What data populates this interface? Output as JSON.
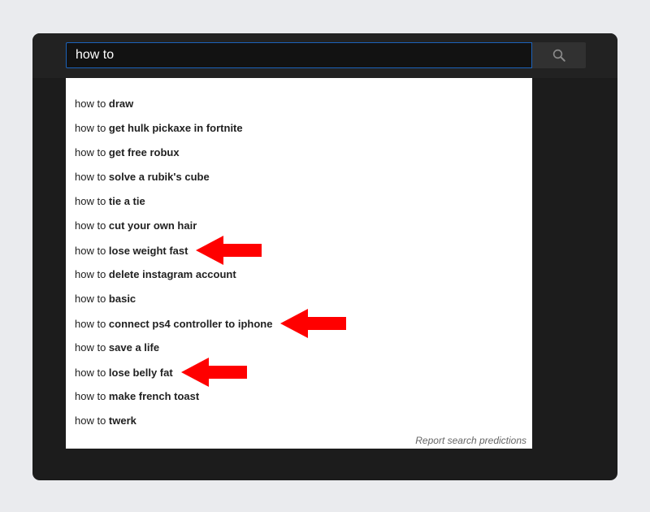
{
  "search": {
    "query": "how to",
    "button_icon": "search-icon"
  },
  "suggestions": [
    {
      "typed": "how to ",
      "completion": "draw",
      "arrow": false
    },
    {
      "typed": "how to ",
      "completion": "get hulk pickaxe in fortnite",
      "arrow": false
    },
    {
      "typed": "how to ",
      "completion": "get free robux",
      "arrow": false
    },
    {
      "typed": "how to ",
      "completion": "solve a rubik's cube",
      "arrow": false
    },
    {
      "typed": "how to ",
      "completion": "tie a tie",
      "arrow": false
    },
    {
      "typed": "how to ",
      "completion": "cut your own hair",
      "arrow": false
    },
    {
      "typed": "how to ",
      "completion": "lose weight fast",
      "arrow": true
    },
    {
      "typed": "how to ",
      "completion": "delete instagram account",
      "arrow": false
    },
    {
      "typed": "how to ",
      "completion": "basic",
      "arrow": false
    },
    {
      "typed": "how to ",
      "completion": "connect ps4 controller to iphone",
      "arrow": true
    },
    {
      "typed": "how to ",
      "completion": "save a life",
      "arrow": false
    },
    {
      "typed": "how to ",
      "completion": "lose belly fat",
      "arrow": true
    },
    {
      "typed": "how to ",
      "completion": "make french toast",
      "arrow": false
    },
    {
      "typed": "how to ",
      "completion": "twerk",
      "arrow": false
    }
  ],
  "report_link": "Report search predictions",
  "colors": {
    "arrow": "#ff0000",
    "input_border": "#1c62b9",
    "frame_bg": "#1c1c1c"
  }
}
